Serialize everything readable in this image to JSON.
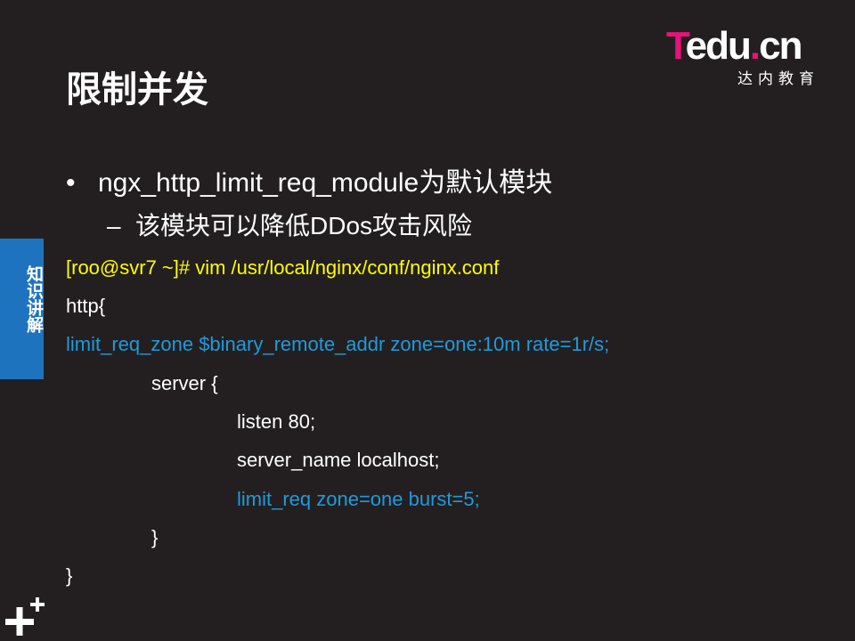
{
  "logo": {
    "brand_T": "T",
    "brand_rest": "edu",
    "brand_dot": ".",
    "brand_cn": "cn",
    "subtitle": "达内教育"
  },
  "title": "限制并发",
  "side_tab": {
    "label": "知识讲解"
  },
  "bullets": [
    {
      "marker": "•",
      "text": "ngx_http_limit_req_module为默认模块"
    },
    {
      "marker": "–",
      "text": "该模块可以降低DDos攻击风险"
    }
  ],
  "code": [
    {
      "text": "[roo@svr7 ~]# vim /usr/local/nginx/conf/nginx.conf",
      "color": "#ffff00"
    },
    {
      "text": "http{",
      "color": "#ffffff"
    },
    {
      "text": "limit_req_zone $binary_remote_addr zone=one:10m rate=1r/s;",
      "color": "#1e9bdc"
    },
    {
      "text": "server {",
      "color": "#ffffff"
    },
    {
      "text": "listen 80;",
      "color": "#ffffff"
    },
    {
      "text": "server_name localhost;",
      "color": "#ffffff"
    },
    {
      "text": "limit_req zone=one burst=5;",
      "color": "#1e9bdc"
    },
    {
      "text": "}",
      "color": "#ffffff"
    },
    {
      "text": "}",
      "color": "#ffffff"
    }
  ],
  "colors": {
    "background": "#231f20",
    "accent_blue": "#1e73be",
    "brand_pink": "#e8127c",
    "command_yellow": "#ffff00",
    "highlight_blue": "#1e9bdc"
  },
  "icons": {
    "corner": "plus-icon"
  }
}
